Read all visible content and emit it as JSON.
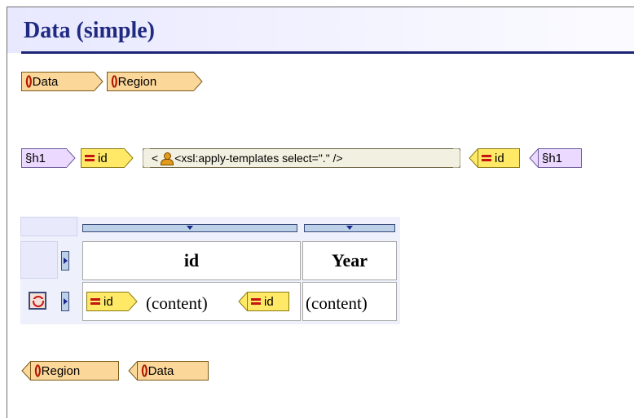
{
  "page": {
    "title": "Data (simple)"
  },
  "top_tags": [
    {
      "icon": "()",
      "label": "Data"
    },
    {
      "icon": "()",
      "label": "Region"
    }
  ],
  "content_line": {
    "h1_start": "§h1",
    "id_start": "id",
    "template_open": "<",
    "template_text": "<xsl:apply-templates select=\".\" />",
    "id_end": "id",
    "h1_end": "§h1"
  },
  "table": {
    "headers": [
      "id",
      "Year"
    ],
    "row": {
      "id_open": "id",
      "cell1_content": "(content)",
      "id_close": "id",
      "cell2_content": "(content)"
    }
  },
  "bottom_tags": [
    {
      "icon": "()",
      "label": "Region"
    },
    {
      "icon": "()",
      "label": "Data"
    }
  ]
}
